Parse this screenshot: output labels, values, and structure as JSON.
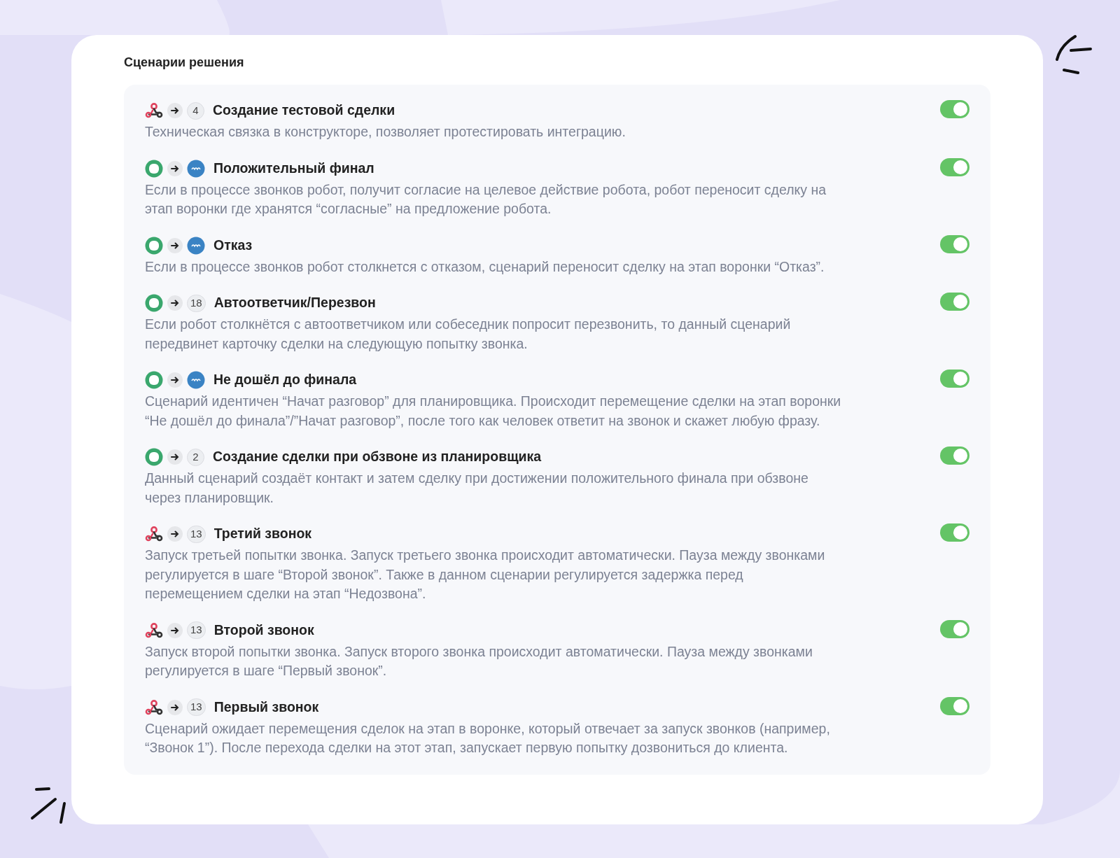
{
  "title": "Сценарии решения",
  "scenarios": [
    {
      "source": {
        "kind": "webhook"
      },
      "target": {
        "kind": "number",
        "text": "4"
      },
      "title": "Создание тестовой сделки",
      "description": "Техническая связка в конструкторе, позволяет протестировать интеграцию.",
      "on": true
    },
    {
      "source": {
        "kind": "app"
      },
      "target": {
        "kind": "amo"
      },
      "title": "Положительный финал",
      "description": "Если в процессе звонков робот, получит согласие на целевое действие робота, робот переносит сделку на этап воронки где хранятся “согласные” на предложение робота.",
      "on": true
    },
    {
      "source": {
        "kind": "app"
      },
      "target": {
        "kind": "amo"
      },
      "title": "Отказ",
      "description": "Если в процессе звонков робот столкнется с отказом, сценарий переносит сделку на этап воронки “Отказ”.",
      "on": true
    },
    {
      "source": {
        "kind": "app"
      },
      "target": {
        "kind": "number",
        "text": "18"
      },
      "title": "Автоответчик/Перезвон",
      "description": "Если робот столкнётся с автоответчиком или собеседник попросит перезвонить, то данный сценарий передвинет карточку сделки на следующую попытку звонка.",
      "on": true
    },
    {
      "source": {
        "kind": "app"
      },
      "target": {
        "kind": "amo"
      },
      "title": "Не дошёл до финала",
      "description": "Сценарий идентичен “Начат разговор” для планировщика. Происходит перемещение сделки на этап воронки “Не дошёл до финала”/”Начат разговор”, после того как человек ответит на звонок и скажет любую фразу.",
      "on": true
    },
    {
      "source": {
        "kind": "app"
      },
      "target": {
        "kind": "number",
        "text": "2"
      },
      "title": "Создание сделки при обзвоне из планировщика",
      "description": "Данный сценарий создаёт контакт и затем сделку при достижении положительного финала при обзвоне через планировщик.",
      "on": true
    },
    {
      "source": {
        "kind": "webhook"
      },
      "target": {
        "kind": "number",
        "text": "13"
      },
      "title": "Третий звонок",
      "description": "Запуск третьей попытки звонка. Запуск третьего звонка происходит автоматически. Пауза между звонками регулируется в шаге “Второй звонок”. Также в данном сценарии регулируется задержка перед перемещением сделки на этап “Недозвона”.",
      "on": true
    },
    {
      "source": {
        "kind": "webhook"
      },
      "target": {
        "kind": "number",
        "text": "13"
      },
      "title": "Второй звонок",
      "description": "Запуск второй попытки звонка. Запуск второго звонка происходит автоматически. Пауза между звонками регулируется в шаге “Первый звонок”.",
      "on": true
    },
    {
      "source": {
        "kind": "webhook"
      },
      "target": {
        "kind": "number",
        "text": "13"
      },
      "title": "Первый звонок",
      "description": "Сценарий ожидает перемещения сделок на этап в воронке, который отвечает за запуск звонков (например, “Звонок 1”). После перехода сделки на этот этап, запускает первую попытку дозвониться до клиента.",
      "on": true
    }
  ]
}
